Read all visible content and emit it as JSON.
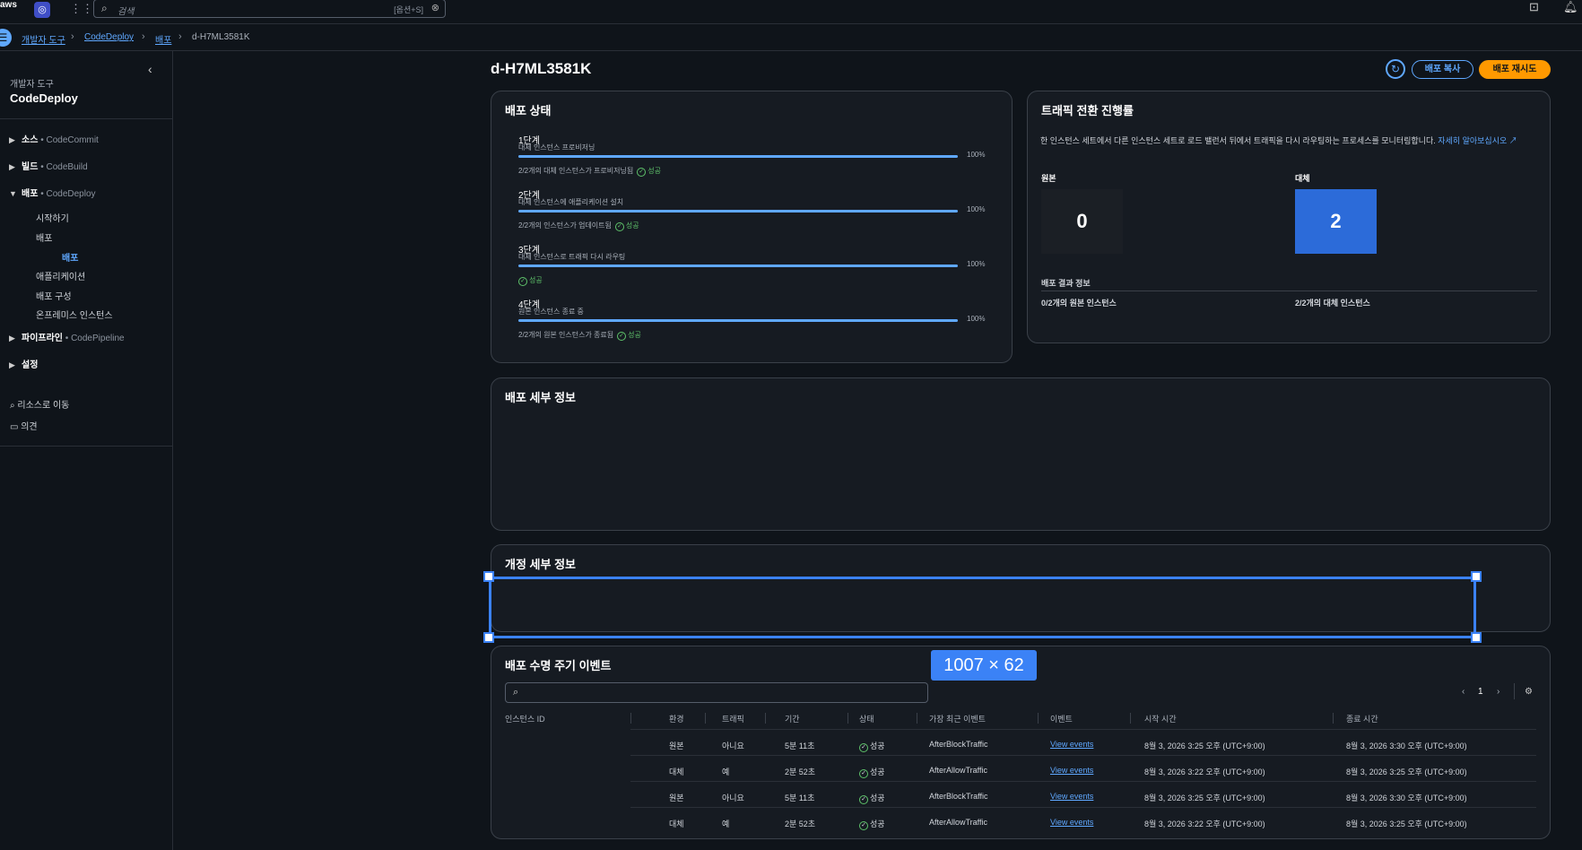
{
  "top": {
    "aws": "aws",
    "search_placeholder": "검색",
    "shortcut": "[옵션+S]"
  },
  "breadcrumb": [
    "개발자 도구",
    "CodeDeploy",
    "배포",
    "d-H7ML3581K"
  ],
  "sidebar": {
    "subtitle": "개발자 도구",
    "title": "CodeDeploy",
    "groups": [
      {
        "label": "소스",
        "service": "CodeCommit"
      },
      {
        "label": "빌드",
        "service": "CodeBuild"
      },
      {
        "label": "배포",
        "service": "CodeDeploy"
      },
      {
        "label": "파이프라인",
        "service": "CodePipeline"
      },
      {
        "label": "설정",
        "service": ""
      }
    ],
    "deploy_items": [
      "시작하기",
      "배포",
      "배포",
      "애플리케이션",
      "배포 구성",
      "온프레미스 인스턴스"
    ],
    "bullet": "•",
    "links": [
      "리소스로 이동",
      "의견"
    ]
  },
  "page": {
    "title": "d-H7ML3581K",
    "copy_button": "배포 복사",
    "retry_button": "배포 재시도"
  },
  "status": {
    "title": "배포 상태",
    "stages": [
      {
        "name": "1단계",
        "desc": "대체 인스턴스 프로비저닝",
        "pct": "100%",
        "progress": 1.0,
        "status_text": "2/2개의 대체 인스턴스가 프로비저닝됨",
        "result": "성공"
      },
      {
        "name": "2단계",
        "desc": "대체 인스턴스에 애플리케이션 설치",
        "pct": "100%",
        "progress": 1.0,
        "status_text": "2/2개의 인스턴스가 업데이트됨",
        "result": "성공"
      },
      {
        "name": "3단계",
        "desc": "대체 인스턴스로 트래픽 다시 라우팅",
        "pct": "100%",
        "progress": 1.0,
        "status_text": "",
        "result": "성공"
      },
      {
        "name": "4단계",
        "desc": "원본 인스턴스 종료 중",
        "pct": "100%",
        "progress": 1.0,
        "status_text": "2/2개의 원본 인스턴스가 종료됨",
        "result": "성공"
      }
    ]
  },
  "traffic": {
    "title": "트래픽 전환 진행률",
    "desc": "한 인스턴스 세트에서 다른 인스턴스 세트로 로드 밸런서 뒤에서 트래픽을 다시 라우팅하는 프로세스를 모니터링합니다.",
    "learn_more": "자세히 알아보십시오",
    "original_label": "원본",
    "original_value": "0",
    "original_color": "#1b1f25",
    "replacement_label": "대체",
    "replacement_value": "2",
    "replacement_color": "#2c6bd9",
    "result_title": "배포 결과 정보",
    "original_result": "0/2개의 원본 인스턴스",
    "replacement_result": "2/2개의 대체 인스턴스"
  },
  "details": {
    "title": "배포 세부 정보"
  },
  "revision": {
    "title": "개정 세부 정보"
  },
  "overlay": {
    "dimension": "1007 × 62"
  },
  "lifecycle": {
    "title": "배포 수명 주기 이벤트",
    "page": "1",
    "headers": [
      "인스턴스 ID",
      "환경",
      "트래픽",
      "기간",
      "상태",
      "가장 최근 이벤트",
      "이벤트",
      "시작 시간",
      "종료 시간"
    ],
    "rows": [
      {
        "env": "원본",
        "traffic": "아니요",
        "duration": "5분 11초",
        "status": "성공",
        "event": "AfterBlockTraffic",
        "link": "View events",
        "start": "8월 3, 2026 3:25 오후 (UTC+9:00)",
        "end": "8월 3, 2026 3:30 오후 (UTC+9:00)"
      },
      {
        "env": "대체",
        "traffic": "예",
        "duration": "2분 52초",
        "status": "성공",
        "event": "AfterAllowTraffic",
        "link": "View events",
        "start": "8월 3, 2026 3:22 오후 (UTC+9:00)",
        "end": "8월 3, 2026 3:25 오후 (UTC+9:00)"
      },
      {
        "env": "원본",
        "traffic": "아니요",
        "duration": "5분 11초",
        "status": "성공",
        "event": "AfterBlockTraffic",
        "link": "View events",
        "start": "8월 3, 2026 3:25 오후 (UTC+9:00)",
        "end": "8월 3, 2026 3:30 오후 (UTC+9:00)"
      },
      {
        "env": "대체",
        "traffic": "예",
        "duration": "2분 52초",
        "status": "성공",
        "event": "AfterAllowTraffic",
        "link": "View events",
        "start": "8월 3, 2026 3:22 오후 (UTC+9:00)",
        "end": "8월 3, 2026 3:25 오후 (UTC+9:00)"
      }
    ]
  }
}
